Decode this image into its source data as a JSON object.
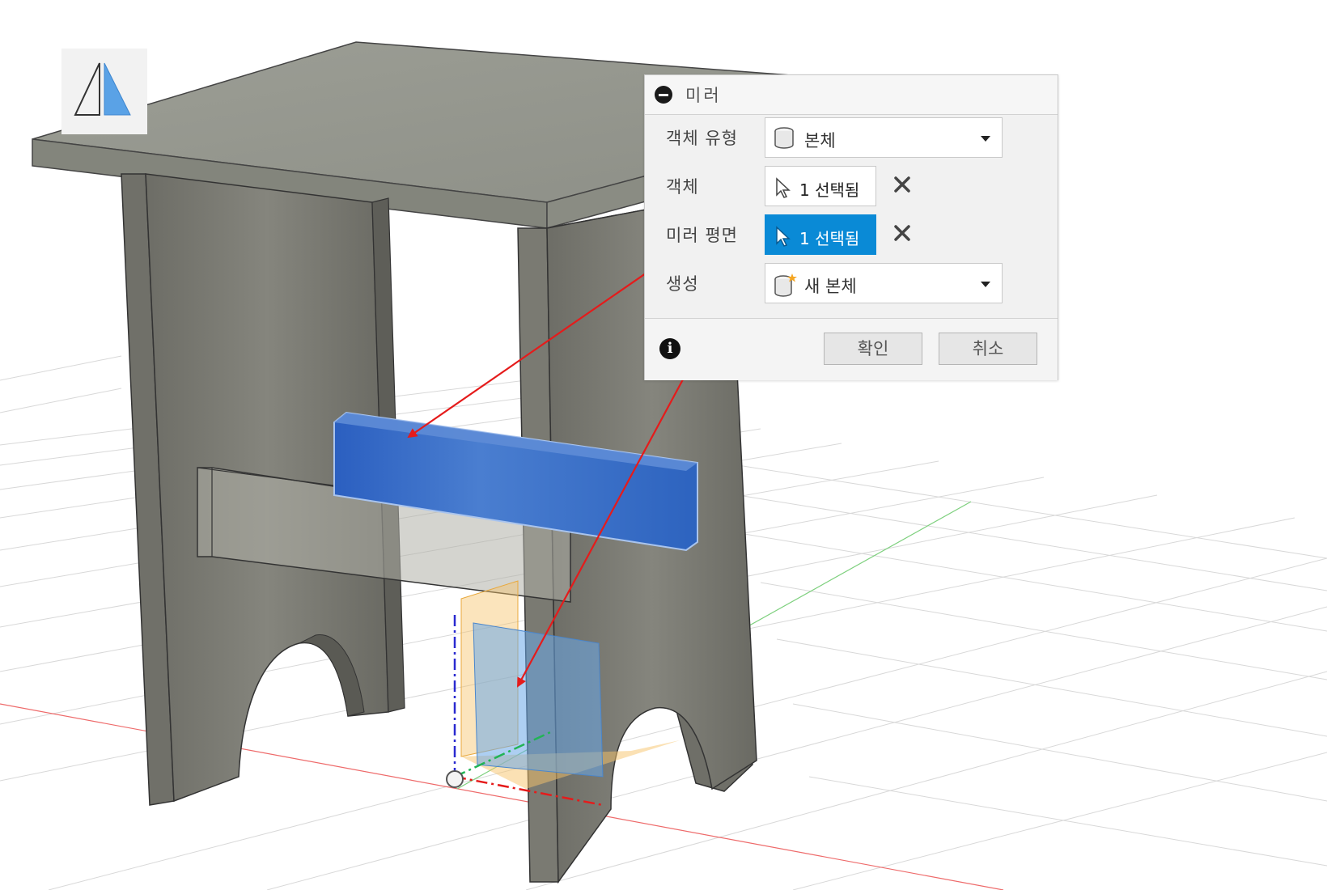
{
  "dialog": {
    "title": "미러",
    "rows": {
      "object_type": {
        "label": "객체 유형",
        "value": "본체"
      },
      "objects": {
        "label": "객체",
        "value": "1 선택됨"
      },
      "mirror_plane": {
        "label": "미러 평면",
        "value": "1 선택됨"
      },
      "operation": {
        "label": "생성",
        "value": "새 본체"
      }
    },
    "ok_label": "확인",
    "cancel_label": "취소"
  },
  "colors": {
    "selection_blue": "#0a8ad6",
    "body_gray": "#7a7a72",
    "selected_body": "#2f63c0",
    "plane_orange": "#f7c46a",
    "annotation_red": "#e51b1b"
  },
  "icons": [
    "mirror-tool-icon",
    "collapse-icon",
    "body-icon",
    "cursor-icon",
    "clear-x-icon",
    "new-body-icon",
    "info-icon"
  ]
}
